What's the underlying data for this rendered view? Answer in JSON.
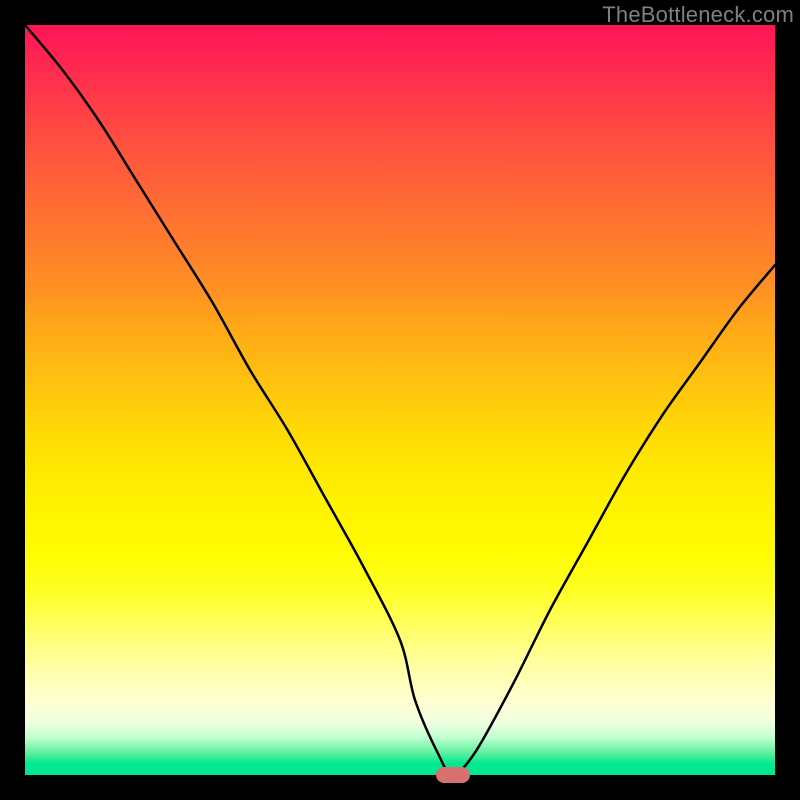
{
  "watermark": "TheBottleneck.com",
  "chart_data": {
    "type": "line",
    "title": "",
    "xlabel": "",
    "ylabel": "",
    "xlim": [
      0,
      100
    ],
    "ylim": [
      0,
      100
    ],
    "x": [
      0,
      5,
      10,
      15,
      20,
      25,
      30,
      35,
      40,
      45,
      50,
      52,
      55,
      57,
      60,
      65,
      70,
      75,
      80,
      85,
      90,
      95,
      100
    ],
    "values": [
      100,
      94,
      87,
      79,
      71,
      63,
      54,
      46,
      37,
      28,
      18,
      10,
      3,
      0,
      3,
      12,
      22,
      31,
      40,
      48,
      55,
      62,
      68
    ],
    "minimum_marker": {
      "x": 57,
      "y": 0,
      "color": "#d87070"
    },
    "background_gradient": {
      "stops": [
        {
          "pos": 0.0,
          "color": "#ff1456"
        },
        {
          "pos": 0.5,
          "color": "#ffcb0b"
        },
        {
          "pos": 0.8,
          "color": "#ffff60"
        },
        {
          "pos": 0.98,
          "color": "#00e890"
        }
      ]
    }
  }
}
